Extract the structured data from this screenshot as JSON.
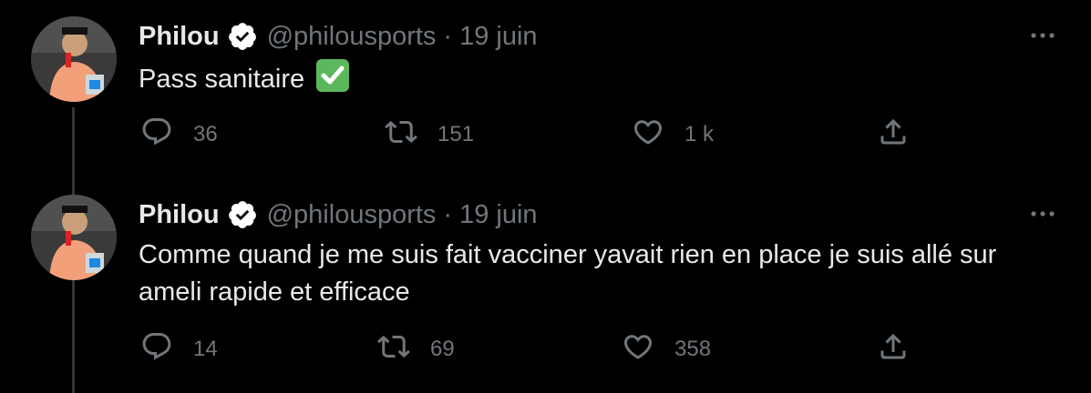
{
  "tweets": [
    {
      "author": {
        "name": "Philou",
        "handle": "@philousports"
      },
      "date": "19 juin",
      "text": "Pass sanitaire",
      "emoji": "check-mark-button",
      "stats": {
        "replies": "36",
        "retweets": "151",
        "likes": "1 k"
      }
    },
    {
      "author": {
        "name": "Philou",
        "handle": "@philousports"
      },
      "date": "19 juin",
      "text": "Comme quand je me suis fait vacciner yavait rien en place je suis allé sur ameli rapide et efficace",
      "stats": {
        "replies": "14",
        "retweets": "69",
        "likes": "358"
      }
    }
  ],
  "colors": {
    "background": "#000000",
    "text": "#e7e9ea",
    "muted": "#71767b",
    "verified_badge": "#ffffff",
    "emoji_check": "#5cb85c"
  },
  "icons": {
    "reply": "reply-icon",
    "retweet": "retweet-icon",
    "like": "heart-icon",
    "share": "share-icon",
    "more": "more-icon",
    "verified": "verified-badge-icon"
  },
  "separator": "·"
}
